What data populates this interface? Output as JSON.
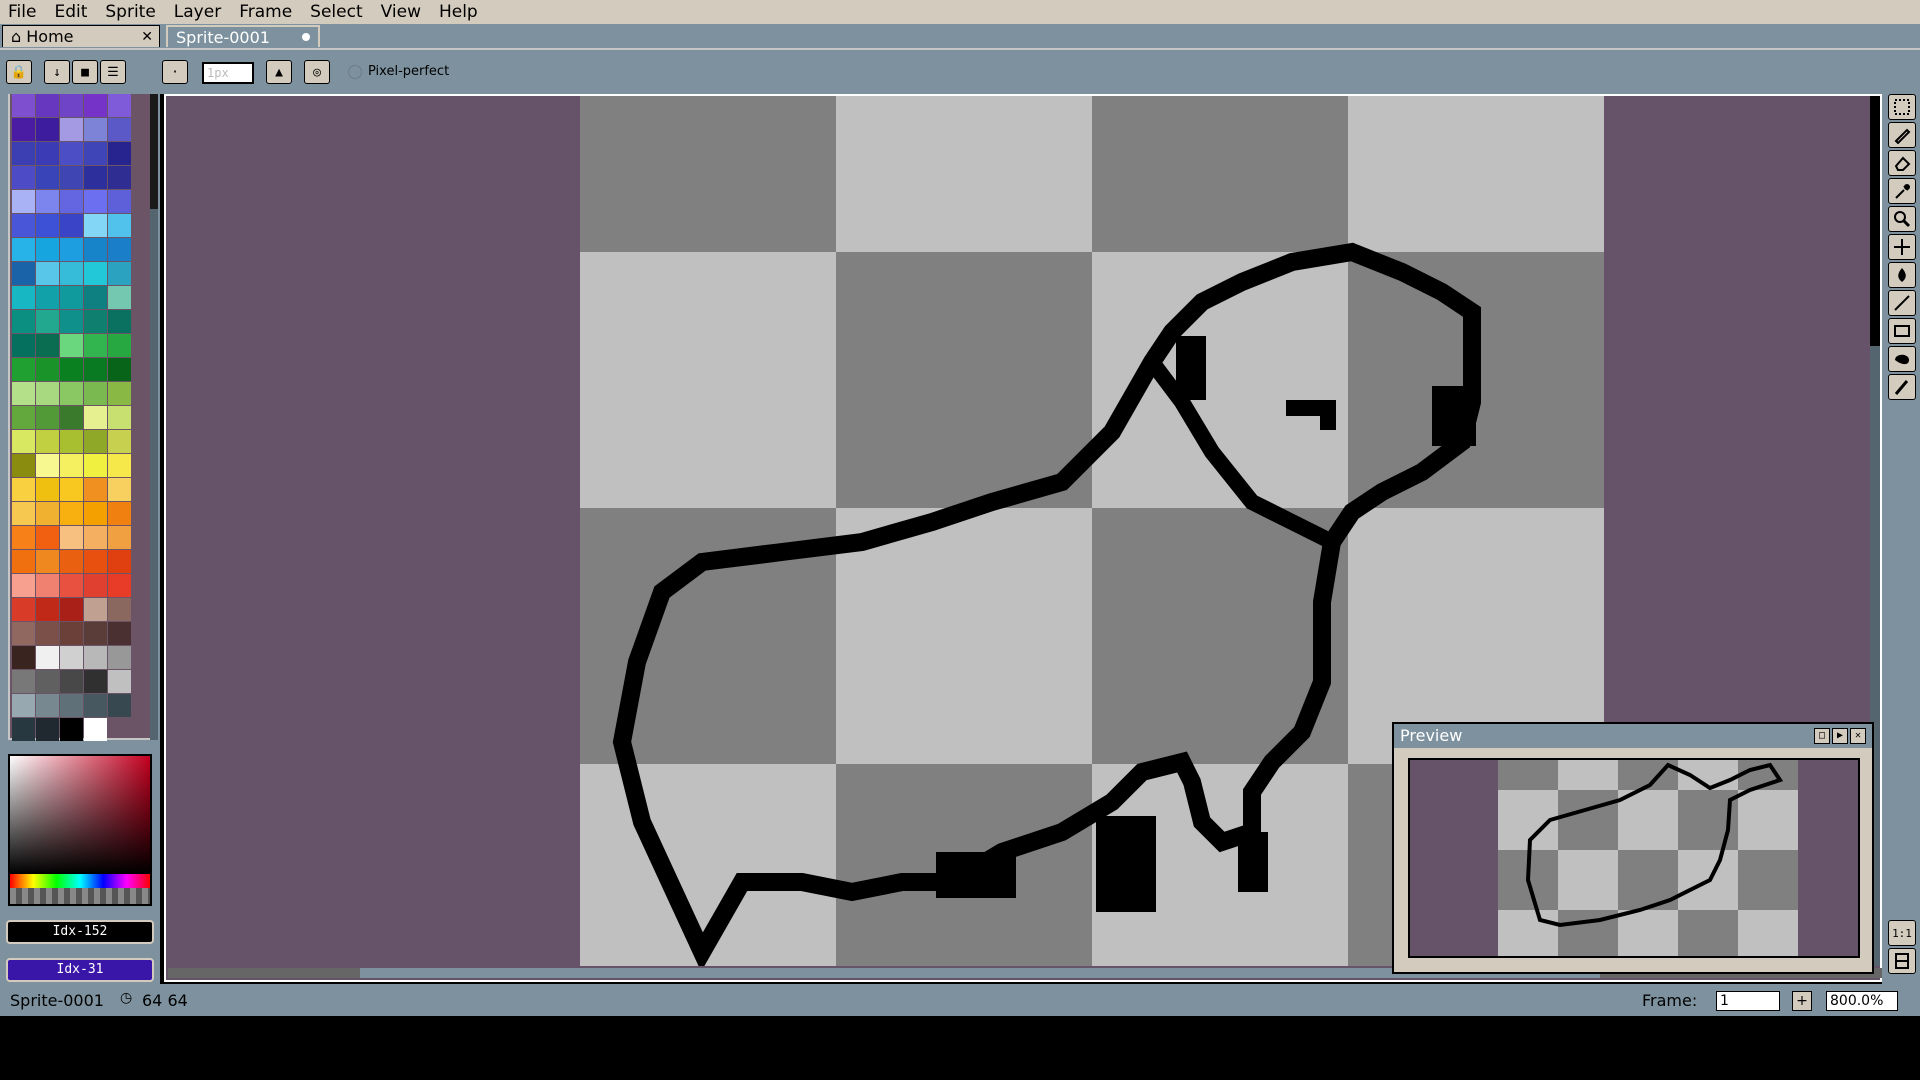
{
  "menu": [
    "File",
    "Edit",
    "Sprite",
    "Layer",
    "Frame",
    "Select",
    "View",
    "Help"
  ],
  "tabs": {
    "home": "Home",
    "sprite": "Sprite-0001"
  },
  "contextbar": {
    "brush_size_placeholder": "1px",
    "pixel_perfect": "Pixel-perfect"
  },
  "palette": {
    "colors": [
      "#7e50d0",
      "#6837c0",
      "#6f44c7",
      "#7633c8",
      "#7f5ad9",
      "#4a1ca3",
      "#3d1c9e",
      "#a49ae4",
      "#7d84d7",
      "#5b58c8",
      "#3c3fb1",
      "#3b3cb5",
      "#4b4ec4",
      "#3f44b6",
      "#28248f",
      "#4d4bc5",
      "#3844b8",
      "#4045b4",
      "#2c2f9c",
      "#2f2c92",
      "#aab2f6",
      "#7c85ee",
      "#6366e0",
      "#6b6ff0",
      "#5d60d8",
      "#4a56d8",
      "#3d51d6",
      "#3a44c6",
      "#83d6f6",
      "#50c2ec",
      "#28b3e8",
      "#17a5e0",
      "#1d9ee1",
      "#1784c9",
      "#1a7ec8",
      "#1a63a8",
      "#58c6e8",
      "#36bbd8",
      "#22c8d8",
      "#2aa2c0",
      "#17b8c4",
      "#11a1a9",
      "#109a9d",
      "#0f8082",
      "#75c8b0",
      "#0b8f80",
      "#22a88e",
      "#10908a",
      "#0f8070",
      "#0a7060",
      "#06705f",
      "#0a6d52",
      "#6ad67e",
      "#32b44e",
      "#28a840",
      "#20a030",
      "#1a9428",
      "#0a8020",
      "#0a7a22",
      "#086418",
      "#b4e08a",
      "#a8d880",
      "#8ac864",
      "#7ab850",
      "#8ab844",
      "#62a83c",
      "#529a38",
      "#3a7a2c",
      "#e6f090",
      "#c8e070",
      "#d8e860",
      "#c0d040",
      "#a8c030",
      "#90a828",
      "#c8d050",
      "#8a8c10",
      "#f8f890",
      "#f4f060",
      "#f0f040",
      "#f6e84a",
      "#f8d040",
      "#f0c010",
      "#f8c820",
      "#f09020",
      "#f8d060",
      "#f6c850",
      "#f0b030",
      "#f8b010",
      "#f4a000",
      "#f08010",
      "#f88018",
      "#f06010",
      "#f8c080",
      "#f4b060",
      "#f0a040",
      "#f07010",
      "#f08820",
      "#e86010",
      "#e85010",
      "#e04010",
      "#f8a090",
      "#f08070",
      "#e85040",
      "#e04030",
      "#e83c28",
      "#d83c28",
      "#c02818",
      "#a82018",
      "#c0a090",
      "#8a6860",
      "#906860",
      "#7a5048",
      "#6a4038",
      "#5a3c38",
      "#4a3030",
      "#3a2420",
      "#f0f0f0",
      "#d0d0d0",
      "#b8b8b8",
      "#989898",
      "#787878",
      "#606060",
      "#484848",
      "#303030",
      "#c0c0c0",
      "#98a8b0",
      "#788890",
      "#607078",
      "#485860",
      "#384850",
      "#283840",
      "#202830",
      "#000000",
      "#ffffff"
    ]
  },
  "color_indices": {
    "fg": "Idx-152",
    "bg": "Idx-31"
  },
  "preview": {
    "title": "Preview"
  },
  "status": {
    "sprite_name": "Sprite-0001",
    "size": "64 64",
    "frame_label": "Frame:",
    "frame_value": "1",
    "zoom": "800.0%"
  },
  "canvas": {
    "checker_dark": "#808080",
    "checker_light": "#c0c0c0",
    "background": "#66536a",
    "outline": "#000000"
  }
}
